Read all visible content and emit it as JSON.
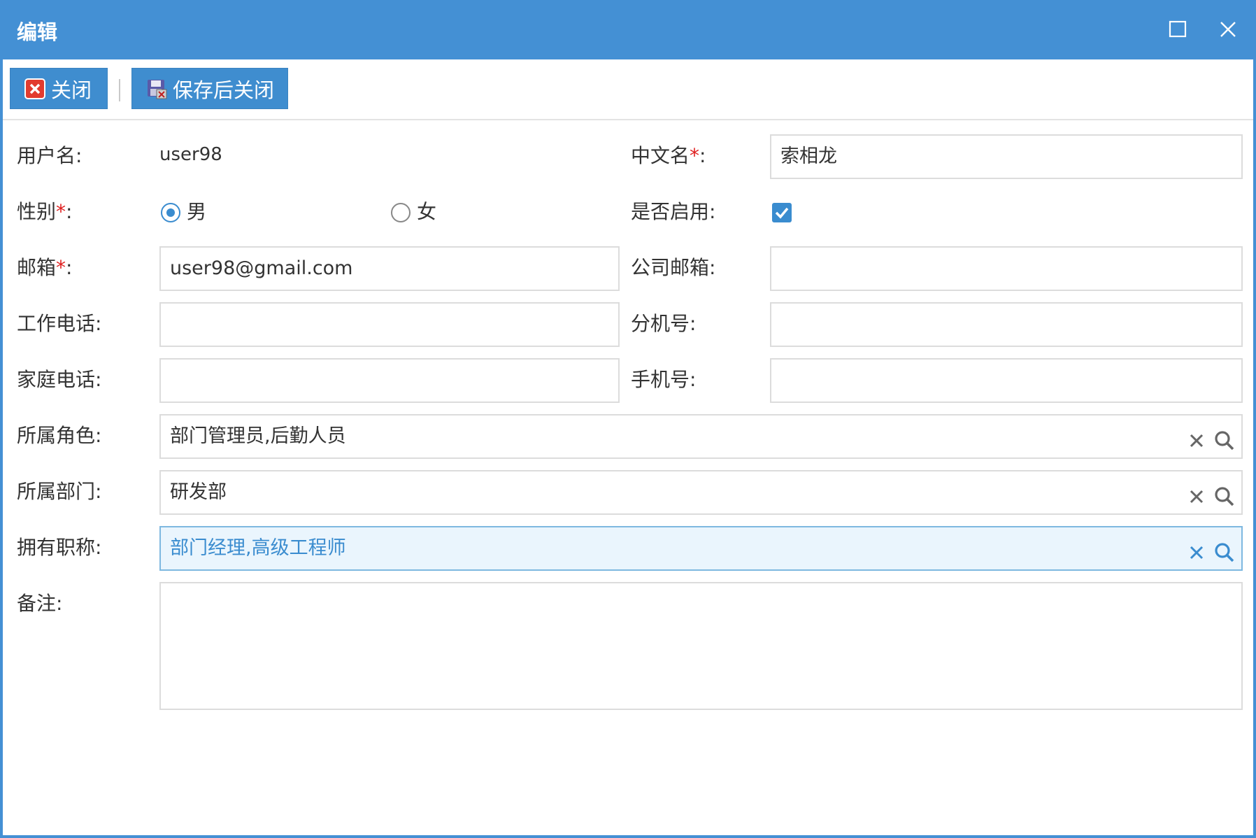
{
  "window": {
    "title": "编辑",
    "maximize_icon": "maximize-icon",
    "close_icon": "close-icon"
  },
  "toolbar": {
    "close_label": "关闭",
    "save_close_label": "保存后关闭"
  },
  "form": {
    "username_label": "用户名:",
    "username_value": "user98",
    "chinese_name_label": "中文名",
    "chinese_name_value": "索相龙",
    "gender_label": "性别",
    "gender_options": [
      "男",
      "女"
    ],
    "gender_selected": "男",
    "enabled_label": "是否启用:",
    "enabled_checked": true,
    "email_label": "邮箱",
    "email_value": "user98@gmail.com",
    "company_email_label": "公司邮箱:",
    "company_email_value": "",
    "work_phone_label": "工作电话:",
    "work_phone_value": "",
    "extension_label": "分机号:",
    "extension_value": "",
    "home_phone_label": "家庭电话:",
    "home_phone_value": "",
    "mobile_label": "手机号:",
    "mobile_value": "",
    "roles_label": "所属角色:",
    "roles_value": "部门管理员,后勤人员",
    "department_label": "所属部门:",
    "department_value": "研发部",
    "titles_label": "拥有职称:",
    "titles_value": "部门经理,高级工程师",
    "notes_label": "备注:",
    "notes_value": "",
    "required_mark": "*",
    "colon": ":"
  },
  "colors": {
    "accent": "#4490d4",
    "required": "#e02020",
    "active_field_bg": "#eaf5fd"
  }
}
